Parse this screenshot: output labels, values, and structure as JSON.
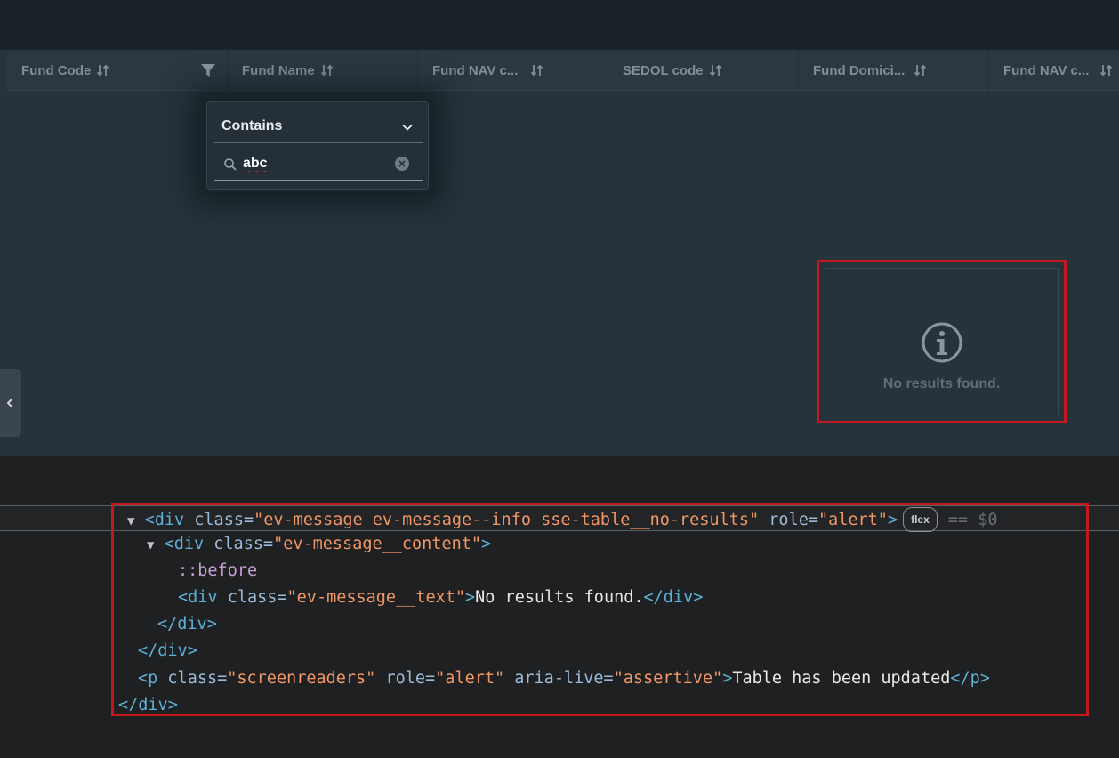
{
  "table": {
    "columns": [
      {
        "label": "Fund Code"
      },
      {
        "label": "Fund Name"
      },
      {
        "label": "Fund NAV c..."
      },
      {
        "label": "SEDOL code"
      },
      {
        "label": "Fund Domici..."
      },
      {
        "label": "Fund NAV c..."
      }
    ],
    "filter": {
      "operator": "Contains",
      "value": "abc"
    },
    "empty_state": {
      "text": "No results found.",
      "icon": "info-icon"
    }
  },
  "devtools": {
    "lines": {
      "l1": {
        "tag_open": "<div",
        "attr1": " class=",
        "val1": "\"ev-message ev-message--info sse-table__no-results\"",
        "attr2": " role=",
        "val2": "\"alert\"",
        "close": ">",
        "badge": "flex",
        "suffix": "== $0"
      },
      "l2": {
        "tag_open": "<div",
        "attr1": " class=",
        "val1": "\"ev-message__content\"",
        "close": ">"
      },
      "l3": {
        "pseudo": "::before"
      },
      "l4": {
        "tag_open": "<div",
        "attr1": " class=",
        "val1": "\"ev-message__text\"",
        "close": ">",
        "text": "No results found.",
        "tag_close": "</div>"
      },
      "l5": {
        "tag_close": "</div>"
      },
      "l6": {
        "tag_close": "</div>"
      },
      "l7": {
        "tag_open": "<p",
        "attr1": " class=",
        "val1": "\"screenreaders\"",
        "attr2": " role=",
        "val2": "\"alert\"",
        "attr3": " aria-live=",
        "val3": "\"assertive\"",
        "close": ">",
        "text": "Table has been updated",
        "tag_close": "</p>"
      },
      "l8": {
        "tag_close": "</div>"
      }
    }
  },
  "colors": {
    "panel_bg": "#27333c",
    "header_bg": "#2b3841",
    "highlight": "#c6161e",
    "devtools_bg": "#1f2021"
  }
}
